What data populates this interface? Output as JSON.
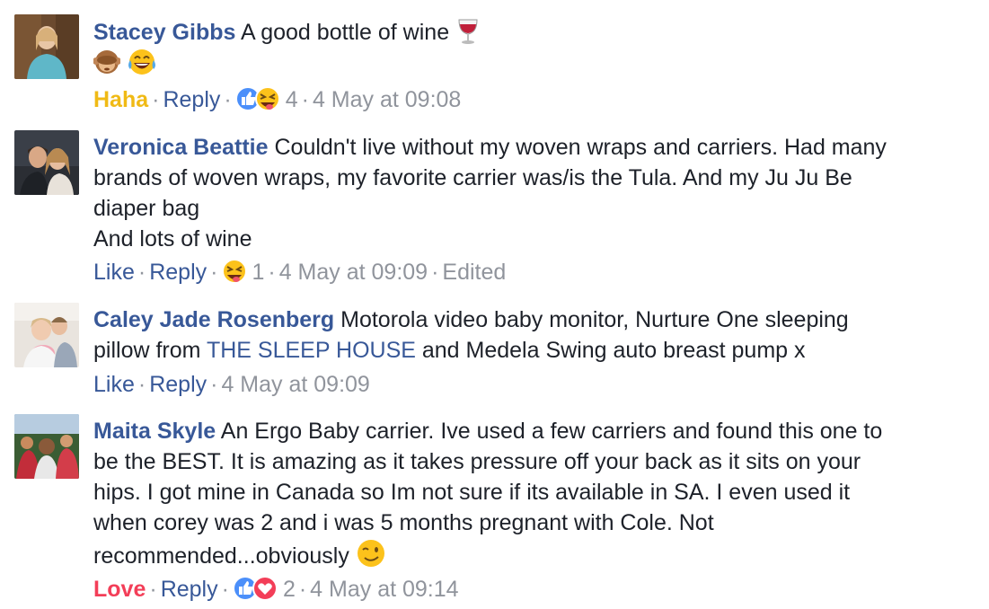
{
  "colors": {
    "name_link": "#385898",
    "text": "#1d2129",
    "meta": "#90949c",
    "haha": "#f0ba15",
    "love": "#f33e58"
  },
  "comments": [
    {
      "author": "Stacey Gibbs",
      "text_lines": [
        "A good bottle of wine"
      ],
      "emojis": [
        "wine-glass",
        "see-no-evil-monkey",
        "tears-of-joy"
      ],
      "reaction_label": "Haha",
      "reply_label": "Reply",
      "reaction_icons": [
        "like",
        "squinting-tongue"
      ],
      "reaction_count": "4",
      "timestamp": "4 May at 09:08"
    },
    {
      "author": "Veronica Beattie",
      "text_lines": [
        "Couldn't live without my woven wraps and carriers. Had many",
        "brands of woven wraps, my favorite carrier was/is the Tula. And my Ju Ju Be",
        "diaper bag",
        "And lots of wine"
      ],
      "reaction_label": "Like",
      "reply_label": "Reply",
      "reaction_icons": [
        "squinting-tongue"
      ],
      "reaction_count": "1",
      "timestamp": "4 May at 09:09",
      "edited_label": "Edited"
    },
    {
      "author": "Caley Jade Rosenberg",
      "text_lines": [
        "Motorola video baby monitor, Nurture One sleeping",
        "pillow from ",
        "THE SLEEP HOUSE",
        " and Medela Swing auto breast pump x"
      ],
      "reaction_label": "Like",
      "reply_label": "Reply",
      "timestamp": "4 May at 09:09"
    },
    {
      "author": "Maita Skyle",
      "text_lines": [
        "An Ergo Baby carrier. Ive used a few carriers and found this one to",
        "be the BEST. It is amazing as it takes pressure off your back as it sits on your",
        "hips. I got mine in Canada so Im not sure if its available in SA. I even used it",
        "when corey was 2 and i was 5 months pregnant with Cole. Not",
        "recommended...obviously"
      ],
      "emojis": [
        "winking-face"
      ],
      "reaction_label": "Love",
      "reply_label": "Reply",
      "reaction_icons": [
        "like",
        "love"
      ],
      "reaction_count": "2",
      "timestamp": "4 May at 09:14"
    }
  ]
}
